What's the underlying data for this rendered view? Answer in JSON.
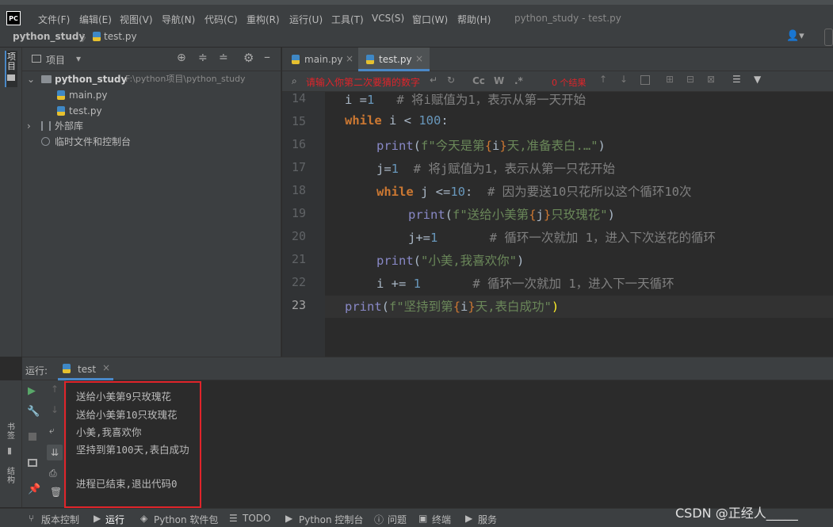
{
  "menubar": {
    "logo": "PC",
    "items": [
      "文件(F)",
      "编辑(E)",
      "视图(V)",
      "导航(N)",
      "代码(C)",
      "重构(R)",
      "运行(U)",
      "工具(T)",
      "VCS(S)",
      "窗口(W)",
      "帮助(H)"
    ],
    "window_title": "python_study - test.py"
  },
  "navbar": {
    "project": "python_study",
    "file": "test.py"
  },
  "leftstrip": {
    "project_tab": "项目"
  },
  "project_panel": {
    "title": "项目",
    "root_name": "python_study",
    "root_path": "F:\\python项目\\python_study",
    "files": [
      "main.py",
      "test.py"
    ],
    "external_libs": "外部库",
    "scratches": "临时文件和控制台"
  },
  "editor": {
    "tabs": [
      "main.py",
      "test.py"
    ],
    "search_placeholder": "请输入你第二次要猜的数字",
    "search_opt_cc": "Cc",
    "search_opt_w": "W",
    "search_opt_re": ".*",
    "search_results": "0 个结果",
    "lines": [
      {
        "n": "14"
      },
      {
        "n": "15"
      },
      {
        "n": "16"
      },
      {
        "n": "17"
      },
      {
        "n": "18"
      },
      {
        "n": "19"
      },
      {
        "n": "20"
      },
      {
        "n": "21"
      },
      {
        "n": "22"
      },
      {
        "n": "23"
      }
    ],
    "code": {
      "l14_a": "i =",
      "l14_b": "1",
      "l14_c": "   # 将i赋值为1，表示从第一天开始",
      "l15_kw": "while",
      "l15_a": " i < ",
      "l15_num": "100",
      "l15_b": ":",
      "l16_fn": "print",
      "l16_a": "(",
      "l16_s1": "f\"今天是第",
      "l16_b1": "{",
      "l16_v": "i",
      "l16_b2": "}",
      "l16_s2": "天,准备表白.…\"",
      "l16_c": ")",
      "l17_a": "j=",
      "l17_num": "1",
      "l17_cm": "  # 将j赋值为1，表示从第一只花开始",
      "l18_kw": "while",
      "l18_a": " j <=",
      "l18_num": "10",
      "l18_b": ":",
      "l18_cm": "  # 因为要送10只花所以这个循环10次",
      "l19_fn": "print",
      "l19_a": "(",
      "l19_s1": "f\"送给小美第",
      "l19_b1": "{",
      "l19_v": "j",
      "l19_b2": "}",
      "l19_s2": "只玫瑰花\"",
      "l19_c": ")",
      "l20_a": "j+=",
      "l20_num": "1",
      "l20_cm": "       # 循环一次就加 1，进入下次送花的循环",
      "l21_fn": "print",
      "l21_a": "(",
      "l21_s": "\"小美,我喜欢你\"",
      "l21_c": ")",
      "l22_a": "i += ",
      "l22_num": "1",
      "l22_cm": "       # 循环一次就加 1，进入下一天循环",
      "l23_fn": "print",
      "l23_a": "(",
      "l23_s1": "f\"坚持到第",
      "l23_b1": "{",
      "l23_v": "i",
      "l23_b2": "}",
      "l23_s2": "天,表白成功\"",
      "l23_c": ")"
    }
  },
  "run_panel": {
    "label": "运行:",
    "tab": "test",
    "output": [
      "送给小美第9只玫瑰花",
      "送给小美第10只玫瑰花",
      "小美,我喜欢你",
      "坚持到第100天,表白成功",
      "",
      "进程已结束,退出代码0"
    ],
    "side_bookmarks": "书签",
    "side_structure": "结构"
  },
  "statusbar": {
    "items": [
      "版本控制",
      "运行",
      "Python 软件包",
      "TODO",
      "Python 控制台",
      "问题",
      "终端",
      "服务"
    ],
    "watermark": "CSDN @正经人_____"
  },
  "colors": {
    "accent_red": "#e0242a",
    "keyword": "#cc7832",
    "string": "#6a8759",
    "number": "#6897bb"
  }
}
